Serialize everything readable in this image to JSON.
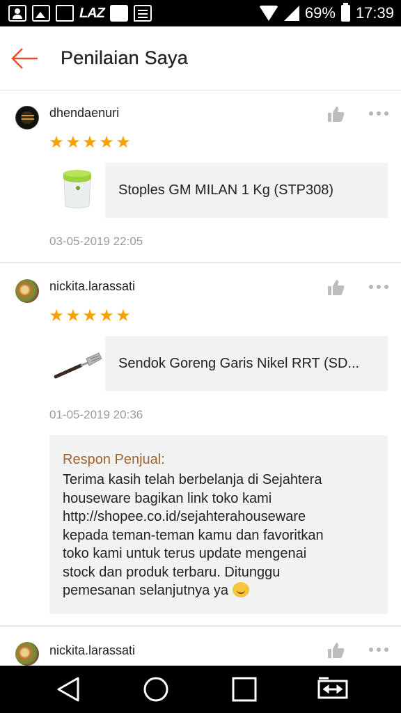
{
  "status_bar": {
    "left_text": "LAZ",
    "battery": "69%",
    "time": "17:39",
    "icons": [
      "contact-card-icon",
      "photo-icon",
      "news-icon",
      "lazada-icon",
      "game-icon",
      "message-icon"
    ]
  },
  "header": {
    "title": "Penilaian Saya",
    "back_icon": "arrow-left-icon",
    "accent_color": "#ee4d2d"
  },
  "reviews": [
    {
      "username": "dhendaenuri",
      "rating": 5,
      "stars": [
        "★",
        "★",
        "★",
        "★",
        "★"
      ],
      "product_name": "Stoples GM MILAN 1 Kg (STP308)",
      "date": "03-05-2019 22:05"
    },
    {
      "username": "nickita.larassati",
      "rating": 5,
      "stars": [
        "★",
        "★",
        "★",
        "★",
        "★"
      ],
      "product_name": "Sendok Goreng Garis Nikel RRT (SD...",
      "date": "01-05-2019 20:36",
      "seller_response": {
        "label": "Respon Penjual:",
        "lines": [
          "Terima kasih telah berbelanja di Sejahtera",
          "houseware bagikan link toko kami",
          "http://shopee.co.id/sejahterahouseware",
          "kepada teman-teman kamu dan favoritkan",
          "toko kami untuk terus update mengenai",
          "stock dan produk terbaru. Ditunggu",
          "pemesanan selanjutnya ya"
        ]
      }
    },
    {
      "username": "nickita.larassati"
    }
  ],
  "colors": {
    "star": "#f6a100",
    "seller_label": "#a0622e",
    "date": "#9b9b9b"
  },
  "nav_bar": {
    "buttons": [
      "back-triangle-icon",
      "home-circle-icon",
      "recents-square-icon",
      "screen-switch-icon"
    ]
  }
}
